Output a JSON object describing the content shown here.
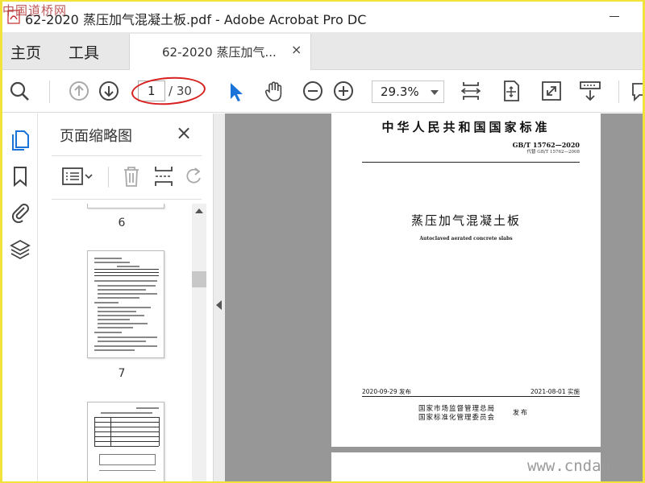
{
  "titlebar": {
    "title": "62-2020 蒸压加气混凝土板.pdf - Adobe Acrobat Pro DC",
    "watermark": "中国道桥网"
  },
  "tabs": {
    "home": "主页",
    "tools": "工具",
    "doc": "62-2020 蒸压加气...",
    "close_glyph": "×"
  },
  "toolbar": {
    "current_page": "1",
    "total_pages": "/ 30",
    "zoom": "29.3%"
  },
  "panel": {
    "title": "页面缩略图",
    "close_glyph": "×",
    "thumbnails": [
      {
        "label": "6"
      },
      {
        "label": "7"
      }
    ]
  },
  "document": {
    "header": "中华人民共和国国家标准",
    "std_number": "GB/T 15762—2020",
    "replaces": "代替 GB/T 15762—2008",
    "title_cn": "蒸压加气混凝土板",
    "title_en": "Autoclaved aerated concrete slabs",
    "issued": "2020-09-29 发布",
    "implemented": "2021-08-01 实施",
    "org1": "国家市场监督管理总局",
    "org2": "国家标准化管理委员会",
    "publish": "发布"
  },
  "footer": {
    "watermark": "www.cndao"
  },
  "colors": {
    "accent_blue": "#1a73d9",
    "annotation_red": "#d82020",
    "viewport_gray": "#979797"
  }
}
